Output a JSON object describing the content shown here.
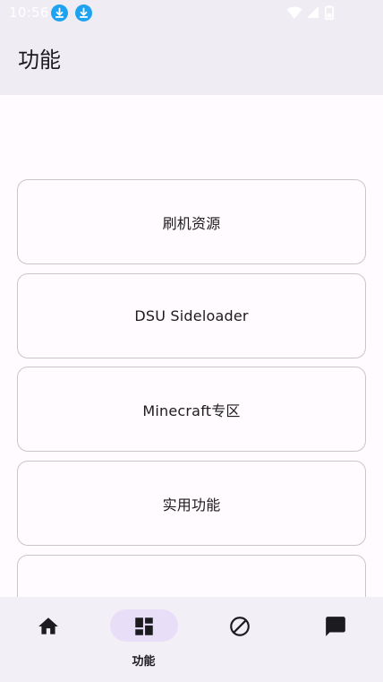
{
  "status_bar": {
    "time": "10:56",
    "icons": [
      "download-notification-icon",
      "download-notification-icon",
      "wifi-icon",
      "cell-signal-icon",
      "battery-icon"
    ]
  },
  "app_bar": {
    "title": "功能"
  },
  "features": [
    {
      "label": "刷机资源"
    },
    {
      "label": "DSU Sideloader"
    },
    {
      "label": "Minecraft专区"
    },
    {
      "label": "实用功能"
    },
    {
      "label": ""
    }
  ],
  "bottom_nav": {
    "items": [
      {
        "icon": "home-icon",
        "label": "",
        "selected": false
      },
      {
        "icon": "dashboard-icon",
        "label": "功能",
        "selected": true
      },
      {
        "icon": "block-icon",
        "label": "",
        "selected": false
      },
      {
        "icon": "chat-icon",
        "label": "",
        "selected": false
      }
    ]
  },
  "colors": {
    "surface": "#fffbfe",
    "app_bar": "#f0ecf4",
    "nav_bar": "#f3eff6",
    "indicator": "#e8def8",
    "outline": "#c9c5cc",
    "on_surface": "#1c1b1f",
    "download_badge": "#1fa3f0"
  }
}
